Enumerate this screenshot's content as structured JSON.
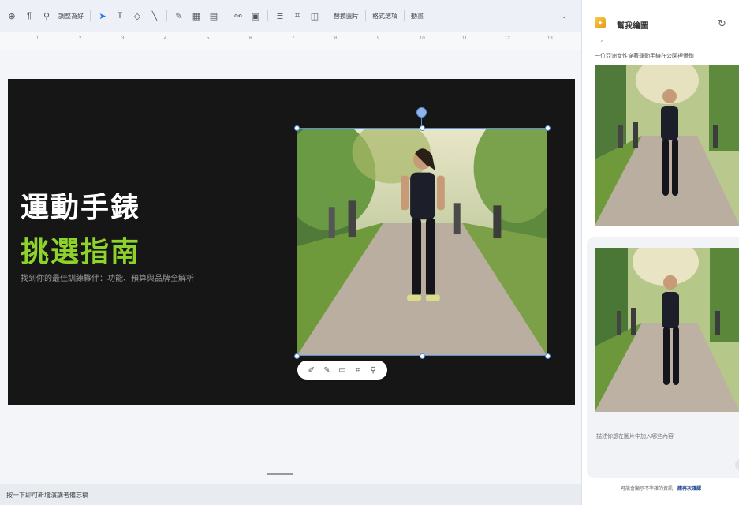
{
  "toolbar": {
    "items": [
      {
        "icon": "add-icon"
      },
      {
        "icon": "paint-format-icon"
      },
      {
        "icon": "zoom-icon"
      },
      {
        "label": "調整為好"
      },
      {
        "icon": "cursor-icon"
      },
      {
        "icon": "textbox-icon"
      },
      {
        "icon": "shape-icon"
      },
      {
        "icon": "line-icon"
      },
      {
        "icon": "pen-icon"
      },
      {
        "icon": "image-icon"
      },
      {
        "icon": "table-icon"
      },
      {
        "icon": "link-icon"
      },
      {
        "icon": "comment-icon"
      },
      {
        "icon": "align-icon"
      },
      {
        "icon": "crop-icon"
      },
      {
        "icon": "mask-icon"
      }
    ],
    "replace_image": "替換圖片",
    "format_options": "格式選項",
    "animation": "動畫"
  },
  "ruler": {
    "ticks": [
      "1",
      "2",
      "3",
      "4",
      "5",
      "6",
      "7",
      "8",
      "9",
      "10",
      "11",
      "12",
      "13"
    ]
  },
  "slide": {
    "title_line1": "運動手錶",
    "title_line2": "挑選指南",
    "subtitle": "找到你的最佳訓練夥伴：功能、預算與品牌全解析",
    "accent_color": "#8ed22c",
    "background_color": "#161616"
  },
  "image_toolbar": {
    "icons": [
      "edit-icon",
      "brush-icon",
      "replace-icon",
      "crop-icon",
      "pin-icon"
    ]
  },
  "notes": {
    "placeholder": "按一下即可新增演講者備忘稿"
  },
  "panel": {
    "title": "幫我繪圖",
    "prompt_text": "一位亞洲女性穿著運動手錶在公園裡慢跑",
    "input_placeholder": "描述你想在圖片中加入哪些內容",
    "footer_text": "可能會顯示不準確的資訊，",
    "footer_link": "請再次確認"
  }
}
